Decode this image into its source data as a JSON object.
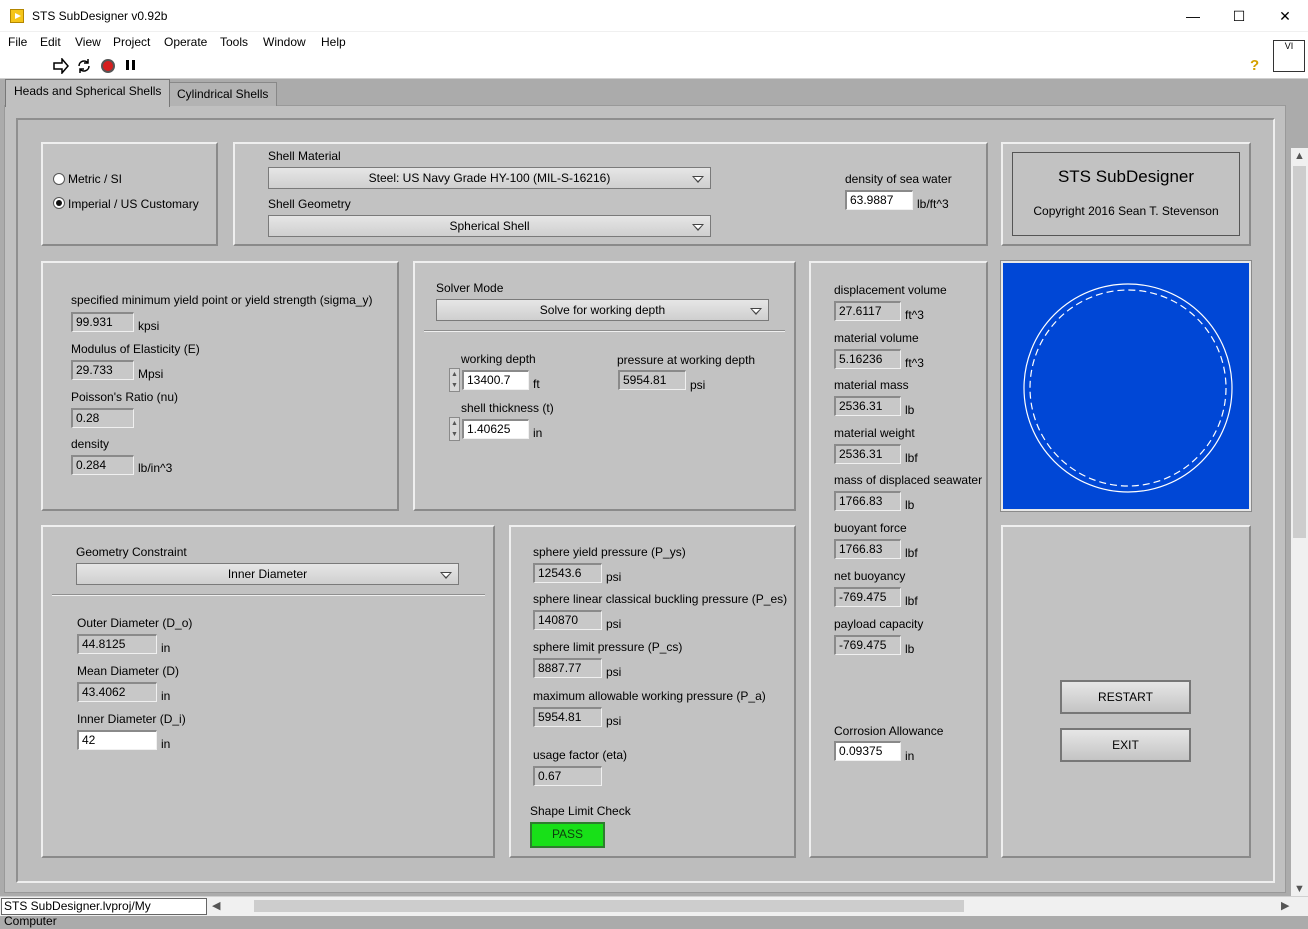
{
  "window": {
    "title": "STS SubDesigner v0.92b",
    "minimize": "—",
    "maximize": "☐",
    "close": "✕"
  },
  "menu": [
    "File",
    "Edit",
    "View",
    "Project",
    "Operate",
    "Tools",
    "Window",
    "Help"
  ],
  "toolbar": {
    "run_icon": "run-arrow-icon",
    "run_continuous_icon": "run-continuously-icon",
    "abort_icon": "abort-icon",
    "pause_icon": "pause-icon",
    "help_icon": "help-icon",
    "help_glyph": "?",
    "vi_icon_text": "VI"
  },
  "tabs": [
    "Heads and Spherical Shells",
    "Cylindrical Shells"
  ],
  "units": {
    "metric_label": "Metric / SI",
    "imperial_label": "Imperial / US Customary",
    "selected": "imperial"
  },
  "shell": {
    "material_label": "Shell Material",
    "material_value": "Steel:  US Navy Grade HY-100 (MIL-S-16216)",
    "geometry_label": "Shell Geometry",
    "geometry_value": "Spherical Shell",
    "sea_density_label": "density of sea water",
    "sea_density_value": "63.9887",
    "sea_density_unit": "lb/ft^3"
  },
  "branding": {
    "title": "STS SubDesigner",
    "copyright": "Copyright 2016 Sean T. Stevenson"
  },
  "material_props": {
    "yield_label": "specified minimum yield point or yield strength (sigma_y)",
    "yield_value": "99.931",
    "yield_unit": "kpsi",
    "modulus_label": "Modulus of Elasticity (E)",
    "modulus_value": "29.733",
    "modulus_unit": "Mpsi",
    "poisson_label": "Poisson's Ratio (nu)",
    "poisson_value": "0.28",
    "density_label": "density",
    "density_value": "0.284",
    "density_unit": "lb/in^3"
  },
  "solver": {
    "mode_label": "Solver Mode",
    "mode_value": "Solve for working depth",
    "depth_label": "working depth",
    "depth_value": "13400.7",
    "depth_unit": "ft",
    "pressure_label": "pressure at working depth",
    "pressure_value": "5954.81",
    "pressure_unit": "psi",
    "thickness_label": "shell thickness (t)",
    "thickness_value": "1.40625",
    "thickness_unit": "in"
  },
  "results": {
    "disp_vol_label": "displacement volume",
    "disp_vol_value": "27.6117",
    "disp_vol_unit": "ft^3",
    "mat_vol_label": "material volume",
    "mat_vol_value": "5.16236",
    "mat_vol_unit": "ft^3",
    "mat_mass_label": "material mass",
    "mat_mass_value": "2536.31",
    "mat_mass_unit": "lb",
    "mat_weight_label": "material weight",
    "mat_weight_value": "2536.31",
    "mat_weight_unit": "lbf",
    "seawater_label": "mass of displaced seawater",
    "seawater_value": "1766.83",
    "seawater_unit": "lb",
    "buoyant_label": "buoyant force",
    "buoyant_value": "1766.83",
    "buoyant_unit": "lbf",
    "net_label": "net buoyancy",
    "net_value": "-769.475",
    "net_unit": "lbf",
    "payload_label": "payload capacity",
    "payload_value": "-769.475",
    "payload_unit": "lb",
    "corrosion_label": "Corrosion Allowance",
    "corrosion_value": "0.09375",
    "corrosion_unit": "in"
  },
  "geometry": {
    "constraint_label": "Geometry Constraint",
    "constraint_value": "Inner Diameter",
    "outer_label": "Outer Diameter (D_o)",
    "outer_value": "44.8125",
    "outer_unit": "in",
    "mean_label": "Mean Diameter (D)",
    "mean_value": "43.4062",
    "mean_unit": "in",
    "inner_label": "Inner Diameter (D_i)",
    "inner_value": "42",
    "inner_unit": "in"
  },
  "pressures": {
    "yield_label": "sphere yield pressure (P_ys)",
    "yield_value": "12543.6",
    "yield_unit": "psi",
    "buckling_label": "sphere linear classical buckling pressure (P_es)",
    "buckling_value": "140870",
    "buckling_unit": "psi",
    "limit_label": "sphere limit pressure (P_cs)",
    "limit_value": "8887.77",
    "limit_unit": "psi",
    "maw_label": "maximum allowable working pressure (P_a)",
    "maw_value": "5954.81",
    "maw_unit": "psi",
    "usage_label": "usage factor (eta)",
    "usage_value": "0.67",
    "shape_label": "Shape Limit Check",
    "shape_value": "PASS"
  },
  "buttons": {
    "restart": "RESTART",
    "exit": "EXIT"
  },
  "colors": {
    "preview_bg": "#0047d6",
    "pass_led": "#18e018"
  },
  "statusbar": {
    "path": "STS SubDesigner.lvproj/My Computer"
  }
}
